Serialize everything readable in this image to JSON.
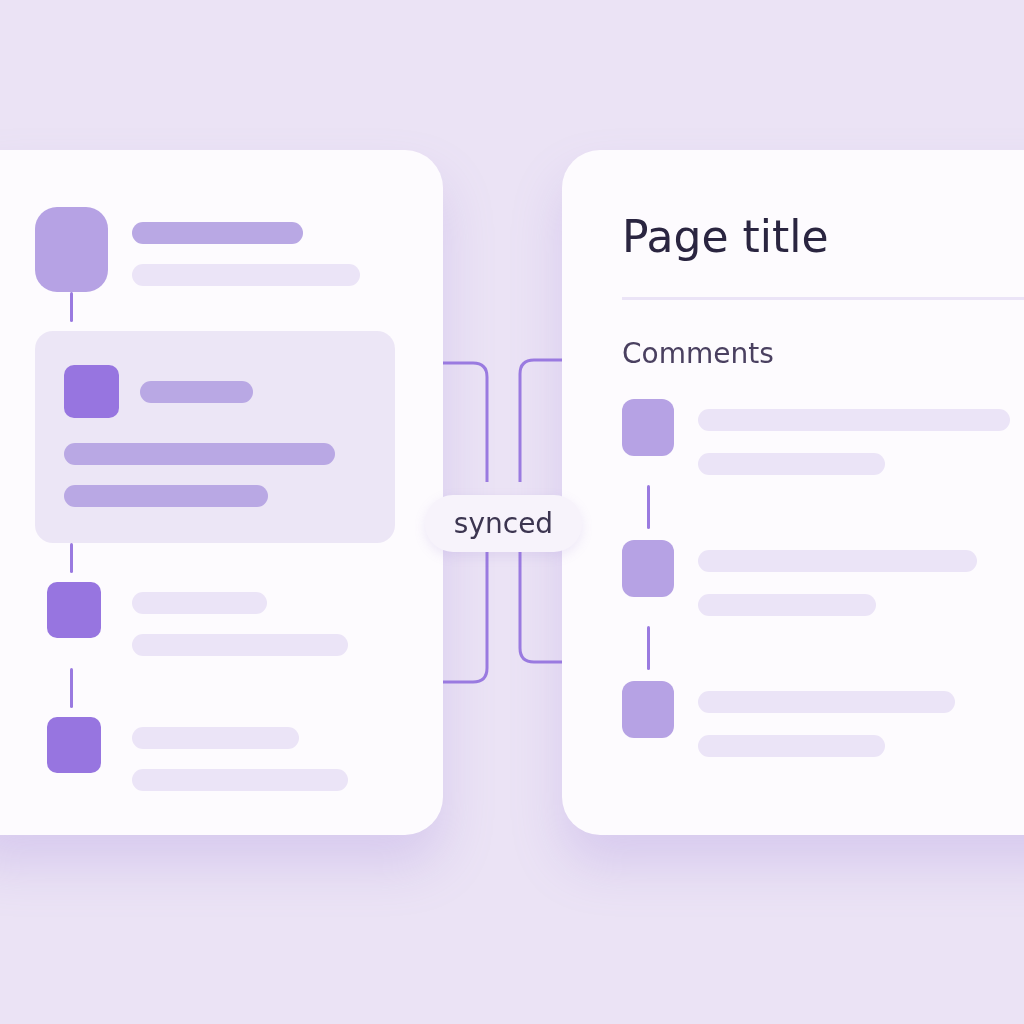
{
  "left_list": {
    "items": [
      {
        "kind": "header",
        "selected": false
      },
      {
        "kind": "entry",
        "selected": true
      },
      {
        "kind": "entry",
        "selected": false
      },
      {
        "kind": "entry",
        "selected": false
      }
    ]
  },
  "sync_badge": "synced",
  "page": {
    "title": "Page title",
    "comments_heading": "Comments",
    "comments": [
      {
        "kind": "placeholder"
      },
      {
        "kind": "placeholder"
      },
      {
        "kind": "placeholder"
      }
    ]
  }
}
